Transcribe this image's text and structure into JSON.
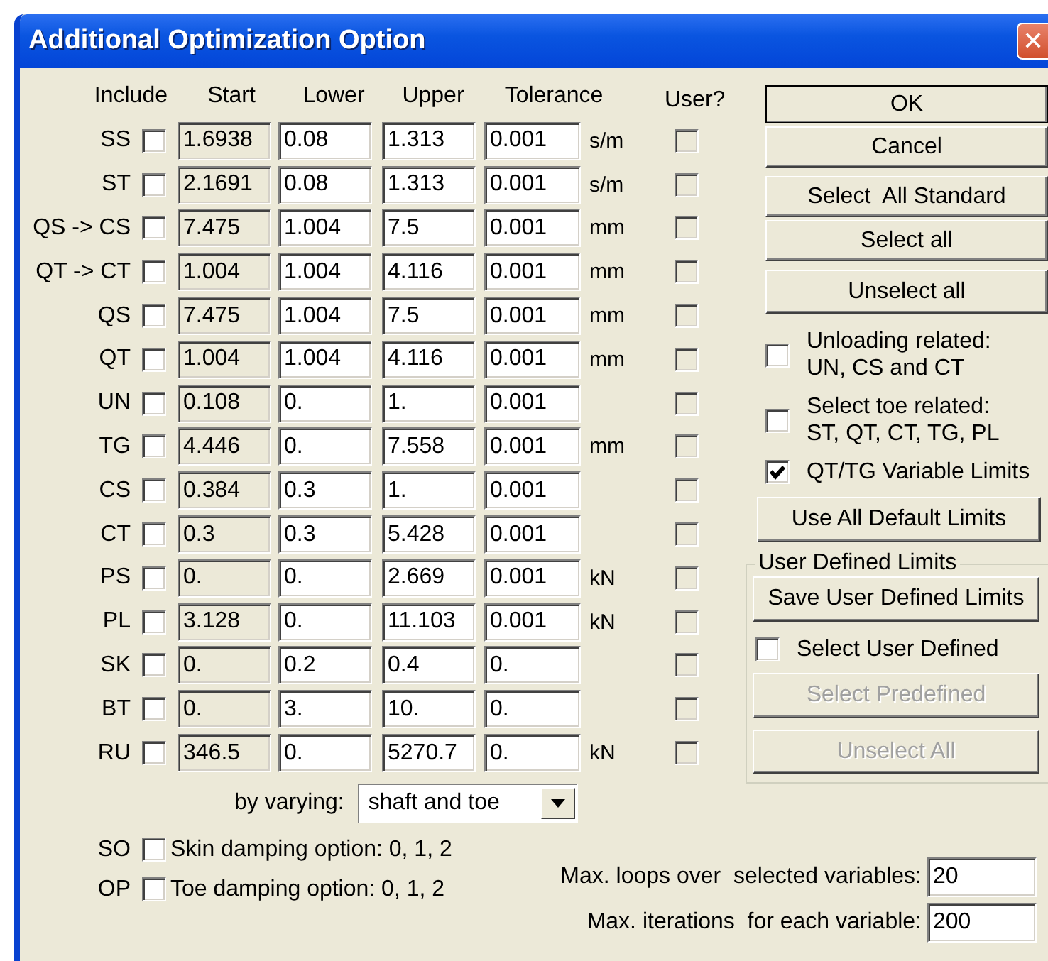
{
  "window": {
    "title": "Additional Optimization Option",
    "close": "✕"
  },
  "headers": {
    "include": "Include",
    "start": "Start",
    "lower": "Lower",
    "upper": "Upper",
    "tolerance": "Tolerance",
    "user": "User?"
  },
  "rows": [
    {
      "label": "SS",
      "include": false,
      "start": "1.6938",
      "lower": "0.08",
      "upper": "1.313",
      "tolerance": "0.001",
      "unit": "s/m",
      "user": false
    },
    {
      "label": "ST",
      "include": false,
      "start": "2.1691",
      "lower": "0.08",
      "upper": "1.313",
      "tolerance": "0.001",
      "unit": "s/m",
      "user": false
    },
    {
      "label": "QS -> CS",
      "include": false,
      "start": "7.475",
      "lower": "1.004",
      "upper": "7.5",
      "tolerance": "0.001",
      "unit": "mm",
      "user": false
    },
    {
      "label": "QT -> CT",
      "include": false,
      "start": "1.004",
      "lower": "1.004",
      "upper": "4.116",
      "tolerance": "0.001",
      "unit": "mm",
      "user": false
    },
    {
      "label": "QS",
      "include": false,
      "start": "7.475",
      "lower": "1.004",
      "upper": "7.5",
      "tolerance": "0.001",
      "unit": "mm",
      "user": false
    },
    {
      "label": "QT",
      "include": false,
      "start": "1.004",
      "lower": "1.004",
      "upper": "4.116",
      "tolerance": "0.001",
      "unit": "mm",
      "user": false
    },
    {
      "label": "UN",
      "include": false,
      "start": "0.108",
      "lower": "0.",
      "upper": "1.",
      "tolerance": "0.001",
      "user": false
    },
    {
      "label": "TG",
      "include": false,
      "start": "4.446",
      "lower": "0.",
      "upper": "7.558",
      "tolerance": "0.001",
      "unit": "mm",
      "user": false
    },
    {
      "label": "CS",
      "include": false,
      "start": "0.384",
      "lower": "0.3",
      "upper": "1.",
      "tolerance": "0.001",
      "user": false
    },
    {
      "label": "CT",
      "include": false,
      "start": "0.3",
      "lower": "0.3",
      "upper": "5.428",
      "tolerance": "0.001",
      "user": false
    },
    {
      "label": "PS",
      "include": false,
      "start": "0.",
      "lower": "0.",
      "upper": "2.669",
      "tolerance": "0.001",
      "unit": "kN",
      "user": false
    },
    {
      "label": "PL",
      "include": false,
      "start": "3.128",
      "lower": "0.",
      "upper": "11.103",
      "tolerance": "0.001",
      "unit": "kN",
      "user": false
    },
    {
      "label": "SK",
      "include": false,
      "start": "0.",
      "lower": "0.2",
      "upper": "0.4",
      "tolerance": "0.",
      "user": false
    },
    {
      "label": "BT",
      "include": false,
      "start": "0.",
      "lower": "3.",
      "upper": "10.",
      "tolerance": "0.",
      "user": false
    },
    {
      "label": "RU",
      "include": false,
      "start": "346.5",
      "lower": "0.",
      "upper": "5270.7",
      "tolerance": "0.",
      "unit": "kN",
      "user": false
    }
  ],
  "varying": {
    "label": "by varying:",
    "value": "shaft and toe"
  },
  "options": [
    {
      "code": "SO",
      "label": "Skin damping option: 0, 1, 2",
      "checked": false
    },
    {
      "code": "OP",
      "label": "Toe damping option: 0, 1, 2",
      "checked": false
    }
  ],
  "loops": [
    {
      "label": "Max. loops over  selected variables:",
      "value": "20"
    },
    {
      "label": "Max. iterations  for each variable:",
      "value": "200"
    }
  ],
  "buttons": [
    {
      "label": "OK",
      "default": true
    },
    {
      "label": "Cancel",
      "default": false
    },
    {
      "label": "Select  All Standard",
      "default": false
    },
    {
      "label": "Select all",
      "default": false
    },
    {
      "label": "Unselect all",
      "default": false
    }
  ],
  "checks": [
    {
      "label": "Unloading related:\nUN, CS and CT",
      "checked": false
    },
    {
      "label": "Select toe related:\nST, QT, CT, TG, PL",
      "checked": false
    },
    {
      "label": "QT/TG Variable Limits",
      "checked": true
    }
  ],
  "default_limits_button": "Use All Default Limits",
  "user_group": {
    "title": "User Defined Limits",
    "items": [
      {
        "kind": "button",
        "label": "Save User Defined Limits",
        "disabled": false
      },
      {
        "kind": "checkbox",
        "label": "Select User Defined",
        "checked": false
      },
      {
        "kind": "button",
        "label": "Select Predefined",
        "disabled": true
      },
      {
        "kind": "button",
        "label": "Unselect All",
        "disabled": true
      }
    ]
  }
}
